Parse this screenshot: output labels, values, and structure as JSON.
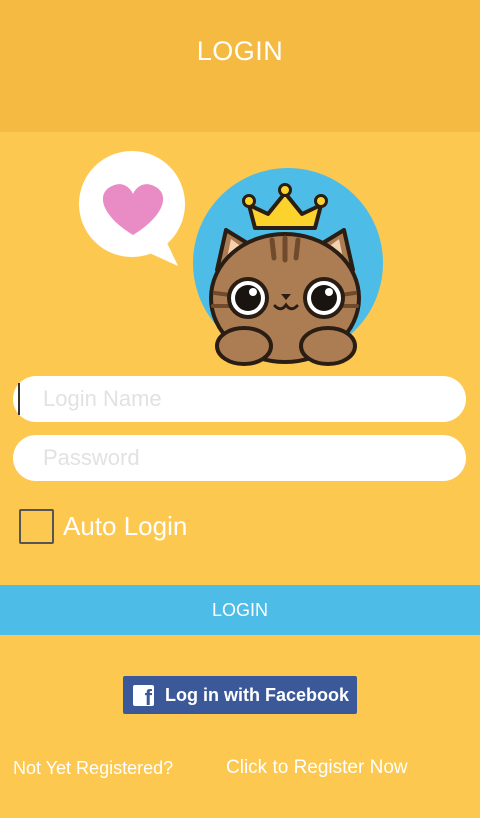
{
  "header": {
    "title": "LOGIN"
  },
  "form": {
    "login_name_placeholder": "Login Name",
    "password_placeholder": "Password",
    "auto_login_label": "Auto Login",
    "auto_login_checked": false,
    "login_button_label": "LOGIN",
    "facebook_button_label": "Log in with Facebook"
  },
  "footer": {
    "not_registered_text": "Not Yet Registered?",
    "register_link": "Click to Register Now"
  },
  "icons": {
    "mascot": "cat-with-crown-icon",
    "bubble": "heart-speech-bubble-icon",
    "facebook": "facebook-logo-icon"
  },
  "colors": {
    "background": "#fdc84f",
    "header": "#f5ba42",
    "login_button": "#4dbde7",
    "facebook": "#3b5998"
  }
}
